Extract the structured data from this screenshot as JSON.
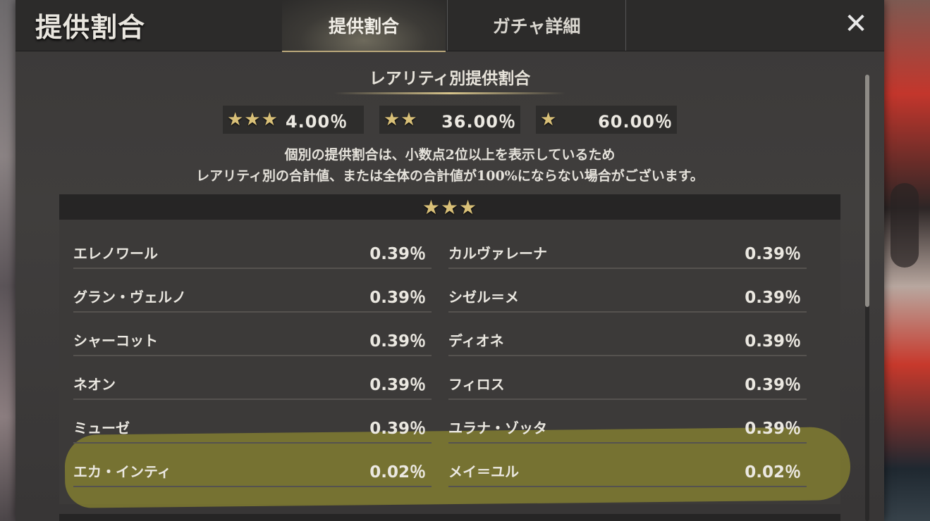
{
  "header": {
    "title": "提供割合",
    "tabs": [
      {
        "label": "提供割合",
        "active": true
      },
      {
        "label": "ガチャ詳細",
        "active": false
      }
    ],
    "close_icon": "close-x-icon"
  },
  "rarity_section": {
    "title": "レアリティ別提供割合",
    "rates": [
      {
        "stars": "★★★",
        "rate": "4.00％"
      },
      {
        "stars": "★★",
        "rate": "36.00％"
      },
      {
        "stars": "★",
        "rate": "60.00％"
      }
    ]
  },
  "notes": {
    "line1": "個別の提供割合は、小数点2位以上を表示しているため",
    "line2": "レアリティ別の合計値、または全体の合計値が100%にならない場合がございます。"
  },
  "list_section": {
    "stars": "★★★",
    "items": [
      {
        "name": "エレノワール",
        "rate": "0.39％"
      },
      {
        "name": "カルヴァレーナ",
        "rate": "0.39％"
      },
      {
        "name": "グラン・ヴェルノ",
        "rate": "0.39％"
      },
      {
        "name": "シゼル＝メ",
        "rate": "0.39％"
      },
      {
        "name": "シャーコット",
        "rate": "0.39％"
      },
      {
        "name": "ディオネ",
        "rate": "0.39％"
      },
      {
        "name": "ネオン",
        "rate": "0.39％"
      },
      {
        "name": "フィロス",
        "rate": "0.39％"
      },
      {
        "name": "ミューゼ",
        "rate": "0.39％"
      },
      {
        "name": "ユラナ・ゾッタ",
        "rate": "0.39％"
      },
      {
        "name": "エカ・インティ",
        "rate": "0.02％"
      },
      {
        "name": "メイ＝ユル",
        "rate": "0.02％"
      }
    ]
  },
  "colors": {
    "star_gold": "#d9c078",
    "highlight": "#a5a02d"
  }
}
